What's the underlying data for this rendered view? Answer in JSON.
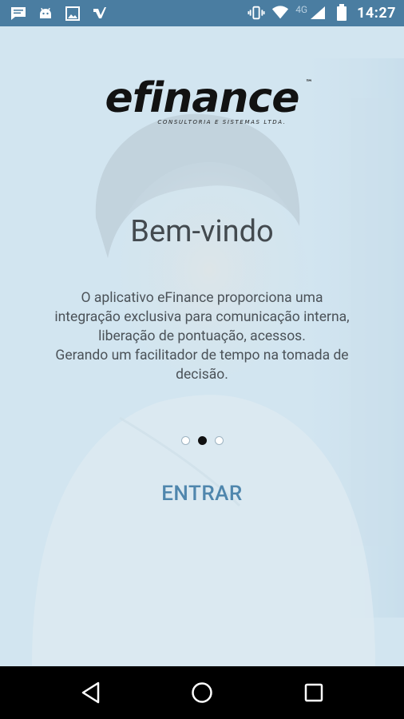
{
  "status_bar": {
    "time": "14:27",
    "network": "4G",
    "icons": [
      "message-icon",
      "android-icon",
      "image-icon",
      "app-icon",
      "vibrate-icon",
      "wifi-icon",
      "signal-icon",
      "battery-icon"
    ]
  },
  "brand": {
    "name": "efinance",
    "trademark": "™",
    "tagline": "CONSULTORIA E SISTEMAS LTDA."
  },
  "content": {
    "title": "Bem-vindo",
    "description_lines": [
      "O aplicativo eFinance proporciona uma",
      "integração exclusiva para comunicação interna,",
      "liberação de pontuação, acessos.",
      "Gerando um facilitador de tempo na tomada de",
      "decisão."
    ]
  },
  "pager": {
    "count": 3,
    "active_index": 1
  },
  "actions": {
    "enter_label": "ENTRAR"
  },
  "colors": {
    "status_bar": "#4a7da1",
    "accent": "#4f86ad",
    "nav_bar": "#000000"
  },
  "nav_bar": {
    "buttons": [
      "back-icon",
      "home-icon",
      "recents-icon"
    ]
  }
}
